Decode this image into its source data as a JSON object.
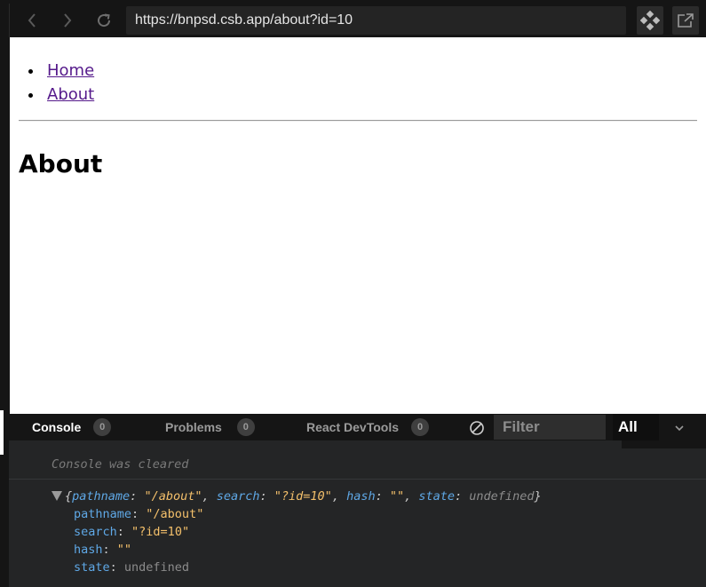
{
  "browser": {
    "url": "https://bnpsd.csb.app/about?id=10"
  },
  "page": {
    "nav_links": [
      {
        "label": "Home"
      },
      {
        "label": "About"
      }
    ],
    "title": "About"
  },
  "devtools": {
    "tabs": [
      {
        "label": "Console",
        "count": "0",
        "active": true
      },
      {
        "label": "Problems",
        "count": "0",
        "active": false
      },
      {
        "label": "React DevTools",
        "count": "0",
        "active": false
      }
    ],
    "filter_placeholder": "Filter",
    "level": "All",
    "console": {
      "cleared_message": "Console was cleared",
      "log": {
        "summary": {
          "open_brace": "{",
          "close_brace": "}",
          "items": [
            {
              "key": "pathname",
              "value": "\"/about\""
            },
            {
              "key": "search",
              "value": "\"?id=10\""
            },
            {
              "key": "hash",
              "value": "\"\""
            },
            {
              "key": "state",
              "value": "undefined"
            }
          ]
        },
        "properties": [
          {
            "key": "pathname",
            "value": "\"/about\""
          },
          {
            "key": "search",
            "value": "\"?id=10\""
          },
          {
            "key": "hash",
            "value": "\"\""
          },
          {
            "key": "state",
            "value": "undefined"
          }
        ]
      }
    }
  },
  "colors": {
    "toolbar_bg": "#151515",
    "link": "#551a8b",
    "console_key": "#5fa8e6",
    "console_string": "#f4c06b",
    "console_undefined": "#8c8c8c"
  }
}
